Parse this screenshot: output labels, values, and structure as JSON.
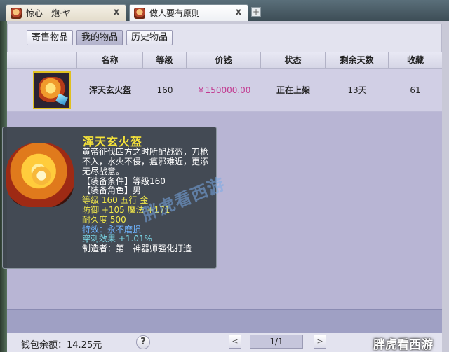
{
  "browser": {
    "tabs": [
      {
        "label": "惊心一炮·ヤ",
        "close": "x",
        "active": false
      },
      {
        "label": "做人要有原则",
        "close": "x",
        "active": true
      }
    ],
    "new_tab": "+"
  },
  "subtabs": [
    {
      "label": "寄售物品",
      "selected": false
    },
    {
      "label": "我的物品",
      "selected": true
    },
    {
      "label": "历史物品",
      "selected": false
    }
  ],
  "table": {
    "columns": [
      "",
      "名称",
      "等级",
      "价钱",
      "状态",
      "剩余天数",
      "收藏"
    ],
    "rows": [
      {
        "icon": "helmet-icon",
        "name": "浑天玄火盔",
        "level": "160",
        "price": "￥150000.00",
        "status": "正在上架",
        "days_left": "13天",
        "favorites": "61"
      }
    ]
  },
  "tooltip": {
    "title": "浑天玄火盔",
    "description": "黄帝征伐四方之时所配战盔，刀枪不入，水火不侵，瘟邪难近，更添无尽战意。",
    "req_level": "【装备条件】等级160",
    "req_role": "【装备角色】男",
    "stats1": "等级 160  五行 金",
    "stats2": "防御 +105 魔法 +171",
    "durability": "耐久度 500",
    "special": "特效：永不磨损",
    "penetration": "穿刺效果 +1.01%",
    "maker": "制造者：第一神器师强化打造"
  },
  "watermark": "胖虎看西游",
  "footer": {
    "wallet": "钱包余额：14.25元",
    "help": "?",
    "prev": "<",
    "page": "1/1",
    "next": ">",
    "corner_mark": "胖虎看西游"
  },
  "colors": {
    "price": "#c2388f",
    "tooltip_title": "#f5e23a",
    "tooltip_bg": "#3e464e",
    "stat_yellow": "#f2e84a",
    "special_blue": "#6fb4ff"
  }
}
